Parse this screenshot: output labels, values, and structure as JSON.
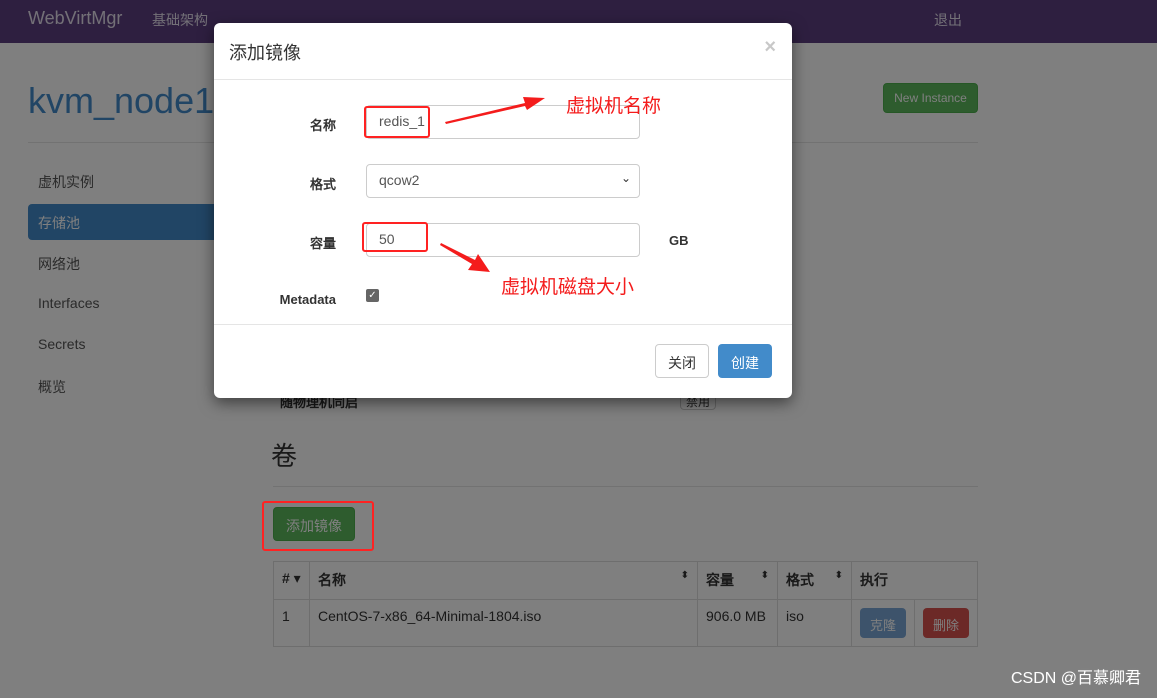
{
  "navbar": {
    "brand": "WebVirtMgr",
    "link": "基础架构",
    "logout": "退出"
  },
  "page": {
    "title": "kvm_node1",
    "new_instance": "New Instance"
  },
  "sidebar": {
    "items": [
      {
        "label": "虚机实例"
      },
      {
        "label": "存储池",
        "active": true
      },
      {
        "label": "网络池"
      },
      {
        "label": "Interfaces"
      },
      {
        "label": "Secrets"
      },
      {
        "label": "概览"
      }
    ]
  },
  "hidden_row": {
    "label": "随物理机同启",
    "button": "禁用"
  },
  "volumes": {
    "heading": "卷",
    "add_button": "添加镜像",
    "columns": [
      "#",
      "名称",
      "容量",
      "格式",
      "执行"
    ],
    "rows": [
      {
        "num": "1",
        "name": "CentOS-7-x86_64-Minimal-1804.iso",
        "size": "906.0 MB",
        "format": "iso",
        "clone": "克隆",
        "delete": "删除"
      }
    ]
  },
  "modal": {
    "title": "添加镜像",
    "close": "×",
    "name_label": "名称",
    "name_value": "redis_1",
    "format_label": "格式",
    "format_value": "qcow2",
    "size_label": "容量",
    "size_value": "50",
    "size_unit": "GB",
    "metadata_label": "Metadata",
    "metadata_checked": true,
    "cancel": "关闭",
    "create": "创建"
  },
  "annotations": {
    "name_note": "虚拟机名称",
    "size_note": "虚拟机磁盘大小",
    "color": "#f41c1c"
  },
  "watermark": "CSDN @百慕卿君"
}
